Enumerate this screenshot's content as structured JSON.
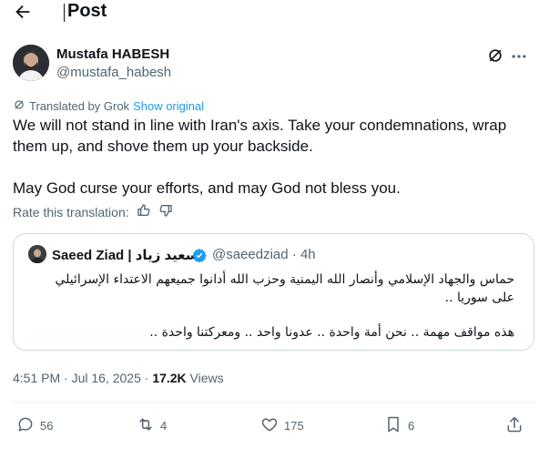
{
  "header": {
    "title": "Post"
  },
  "author": {
    "name": "Mustafa HABESH",
    "handle": "@mustafa_habesh"
  },
  "translation": {
    "label": "Translated by Grok",
    "show_original": "Show original",
    "rate_label": "Rate this translation:"
  },
  "post": {
    "paragraph1": "We will not stand in line with Iran's axis. Take your condemnations, wrap them up, and shove them up your backside.",
    "paragraph2": "May God curse your efforts, and may God not bless you."
  },
  "quote": {
    "name": "Saeed Ziad | سعيد زياد",
    "meta": "@saeedziad · 4h",
    "line1": "حماس والجهاد الإسلامي وأنصار الله اليمنية وحزب الله أدانوا جميعهم الاعتداء الإسرائيلي على سوريا ..",
    "line2": "هذه مواقف مهمة .. نحن أمة واحدة .. عدونا واحد .. ومعركتنا واحدة .."
  },
  "meta": {
    "time_date": "4:51 PM · Jul 16, 2025 · ",
    "views_count": "17.2K",
    "views_label": " Views"
  },
  "actions": {
    "replies": "56",
    "reposts": "4",
    "likes": "175",
    "bookmarks": "6"
  },
  "colors": {
    "accent": "#1d9bf0",
    "secondary_text": "#536471",
    "border": "#cfd9de"
  }
}
